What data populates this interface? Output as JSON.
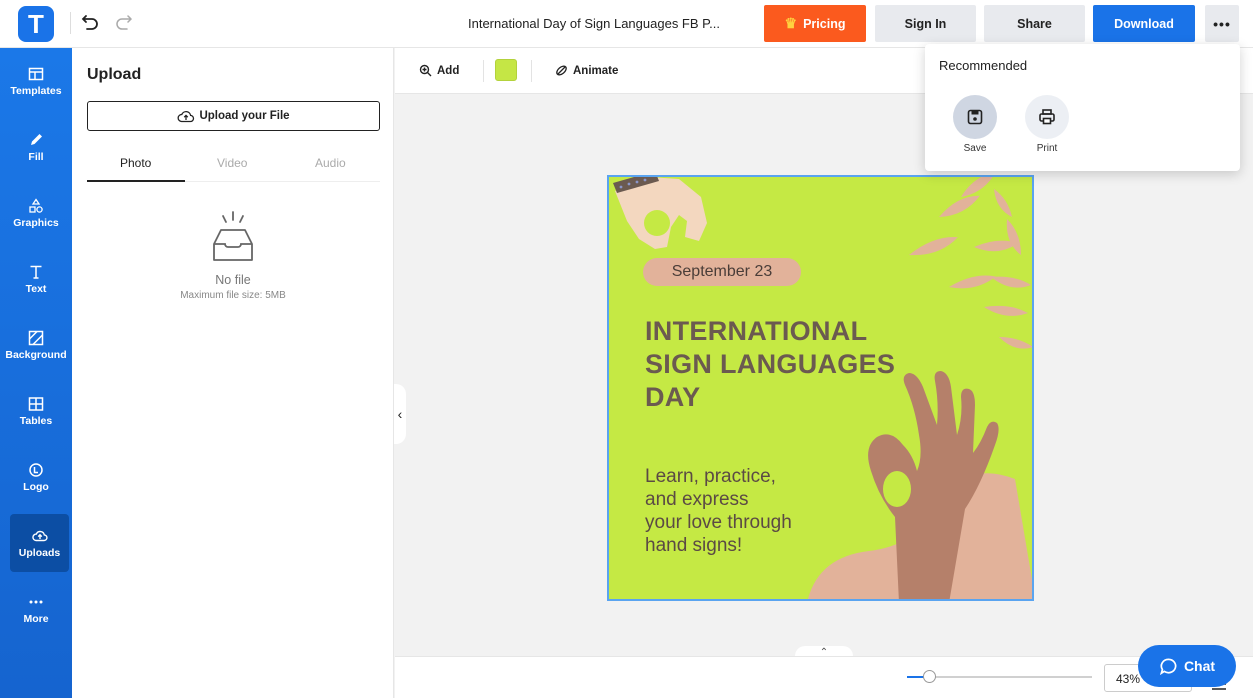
{
  "app": {
    "logo_letter": "T"
  },
  "header": {
    "document_title": "International Day of Sign Languages FB P...",
    "pricing_label": "Pricing",
    "signin_label": "Sign In",
    "share_label": "Share",
    "download_label": "Download",
    "more_label": "•••"
  },
  "sidebar": {
    "items": [
      {
        "label": "Templates"
      },
      {
        "label": "Fill"
      },
      {
        "label": "Graphics"
      },
      {
        "label": "Text"
      },
      {
        "label": "Background"
      },
      {
        "label": "Tables"
      },
      {
        "label": "Logo"
      },
      {
        "label": "Uploads"
      },
      {
        "label": "More"
      }
    ],
    "active": "Uploads"
  },
  "panel": {
    "title": "Upload",
    "upload_button": "Upload your File",
    "tabs": [
      {
        "label": "Photo"
      },
      {
        "label": "Video"
      },
      {
        "label": "Audio"
      }
    ],
    "active_tab": "Photo",
    "empty_title": "No file",
    "empty_subtitle": "Maximum file size: 5MB"
  },
  "toolbar": {
    "add_label": "Add",
    "fill_color": "#c5e645",
    "animate_label": "Animate"
  },
  "design": {
    "date": "September 23",
    "headline": [
      "INTERNATIONAL",
      "SIGN LANGUAGES",
      "DAY"
    ],
    "body": [
      "Learn, practice,",
      "and express",
      "your love through",
      "hand signs!"
    ],
    "background_color": "#c5e944",
    "accent_color": "#e2b29a",
    "text_color": "#6b5a50"
  },
  "download_menu": {
    "title": "Recommended",
    "items": [
      {
        "label": "Save",
        "icon": "save-icon"
      },
      {
        "label": "Print",
        "icon": "print-icon"
      }
    ]
  },
  "footer": {
    "zoom": "43%",
    "chat_label": "Chat"
  },
  "colors": {
    "brand_blue": "#1a73e8",
    "pricing_orange": "#fb5a1e"
  }
}
